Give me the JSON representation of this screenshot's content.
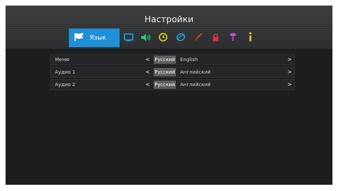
{
  "title": "Настройки",
  "tabs": [
    {
      "icon": "flag-icon",
      "label": "Язык",
      "active": true,
      "color": "#ffffff"
    },
    {
      "icon": "tv-icon",
      "color": "#1f9be0"
    },
    {
      "icon": "speaker-icon",
      "color": "#28c87a"
    },
    {
      "icon": "clock-icon",
      "color": "#e9d21a"
    },
    {
      "icon": "globe-icon",
      "color": "#2aa0dc"
    },
    {
      "icon": "brush-icon",
      "color": "#e03a2a"
    },
    {
      "icon": "lock-icon",
      "color": "#e02a4a"
    },
    {
      "icon": "antenna-icon",
      "color": "#c84ad0"
    },
    {
      "icon": "info-icon",
      "color": "#f0c020"
    }
  ],
  "rows": [
    {
      "label": "Меню",
      "selected": "Русский",
      "alternative": "English"
    },
    {
      "label": "Аудио 1",
      "selected": "Русский",
      "alternative": "Английский"
    },
    {
      "label": "Аудио 2",
      "selected": "Русский",
      "alternative": "Английский"
    }
  ],
  "arrows": {
    "left": "<",
    "right": ">"
  }
}
